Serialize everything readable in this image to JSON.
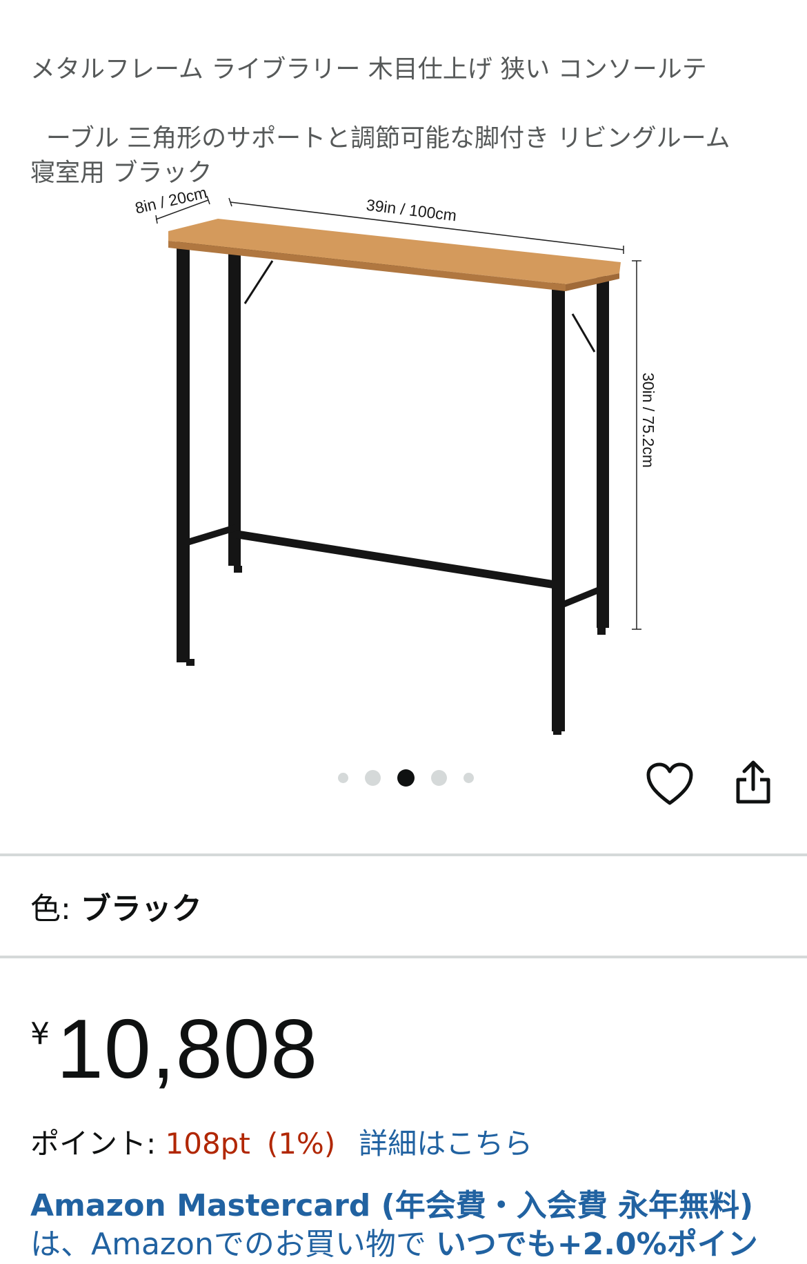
{
  "product": {
    "title": "ーブル 三角形のサポートと調節可能な脚付き リビングルーム\n寝室用 ブラック",
    "title_cutoff_line": "メタルフレーム ライブラリー 木目仕上げ 狭い コンソールテ"
  },
  "image": {
    "dim_depth": "8in / 20cm",
    "dim_width": "39in / 100cm",
    "dim_height": "30in / 75.2cm"
  },
  "carousel": {
    "dot_count": 5,
    "active_index": 2
  },
  "actions": {
    "wishlist_icon": "heart-icon",
    "share_icon": "share-icon"
  },
  "color": {
    "label": "色: ",
    "value": "ブラック"
  },
  "price": {
    "currency": "¥",
    "amount": "10,808"
  },
  "points": {
    "label": "ポイント: ",
    "value": "108pt",
    "percent": "(1%)",
    "details_link": "詳細はこちら"
  },
  "promo": {
    "line1": "Amazon Mastercard (年会費・入会費 永年無料)",
    "line2_prefix": "は、Amazonでのお買い物で ",
    "line2_bold": "いつでも+2.0%ポイン"
  },
  "colors": {
    "link": "#2162a1",
    "price_red": "#b12704",
    "divider": "#d5d9d9",
    "tabletop": "#d49a5c"
  }
}
